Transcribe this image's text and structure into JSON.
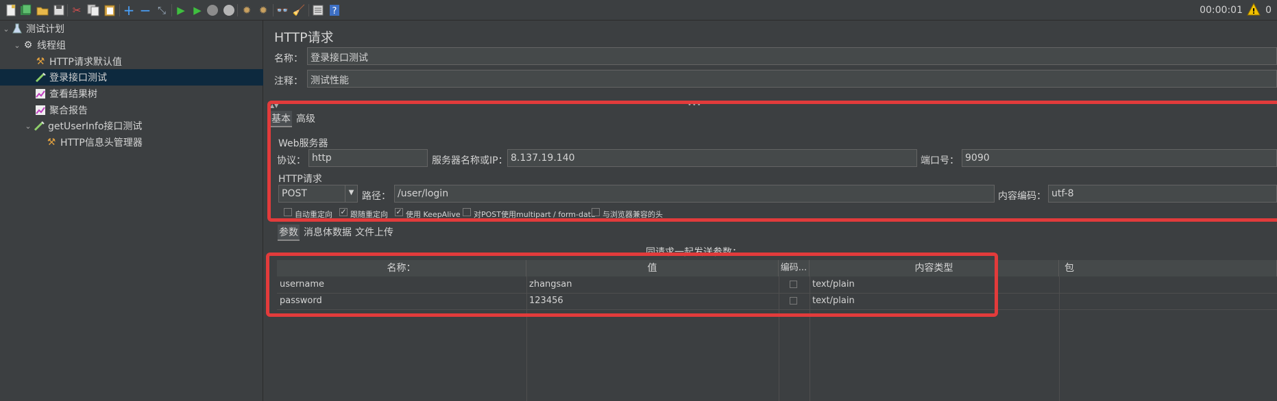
{
  "toolbar": {
    "icons": [
      "new-icon",
      "templates-icon",
      "open-icon",
      "save-icon",
      "cut-icon",
      "copy-icon",
      "paste-icon",
      "expand-icon",
      "collapse-icon",
      "toggle-icon",
      "start-icon",
      "start-no-pause-icon",
      "stop-icon",
      "shutdown-icon",
      "clear-icon",
      "clear-all-icon",
      "search-icon",
      "reset-search-icon",
      "function-helper-icon",
      "help-icon"
    ],
    "timer": "00:00:01",
    "warning_count": "0"
  },
  "tree": {
    "items": [
      {
        "label": "测试计划",
        "icon": "flask-icon",
        "expanded": true
      },
      {
        "label": "线程组",
        "icon": "gear-icon",
        "expanded": true
      },
      {
        "label": "HTTP请求默认值",
        "icon": "wrench-icon"
      },
      {
        "label": "登录接口测试",
        "icon": "pipette-icon",
        "selected": true
      },
      {
        "label": "查看结果树",
        "icon": "chart-icon"
      },
      {
        "label": "聚合报告",
        "icon": "chart-icon"
      },
      {
        "label": "getUserInfo接口测试",
        "icon": "pipette-icon",
        "expanded": true
      },
      {
        "label": "HTTP信息头管理器",
        "icon": "wrench-icon"
      }
    ]
  },
  "main": {
    "title": "HTTP请求",
    "name_label": "名称：",
    "name_value": "登录接口测试",
    "comment_label": "注释：",
    "comment_value": "测试性能",
    "tabs": [
      "基本",
      "高级"
    ],
    "web_server": {
      "section": "Web服务器",
      "protocol_label": "协议：",
      "protocol": "http",
      "server_label": "服务器名称或IP：",
      "server": "8.137.19.140",
      "port_label": "端口号：",
      "port": "9090"
    },
    "http_request": {
      "section": "HTTP请求",
      "method": "POST",
      "path_label": "路径：",
      "path": "/user/login",
      "encoding_label": "内容编码：",
      "encoding": "utf-8"
    },
    "options": [
      {
        "label": "自动重定向",
        "checked": false
      },
      {
        "label": "跟随重定向",
        "checked": true
      },
      {
        "label": "使用 KeepAlive",
        "checked": true
      },
      {
        "label": "对POST使用multipart / form-data",
        "checked": false
      },
      {
        "label": "与浏览器兼容的头",
        "checked": false
      }
    ],
    "param_tabs": [
      "参数",
      "消息体数据",
      "文件上传"
    ],
    "params_caption": "同请求一起发送参数：",
    "table": {
      "headers": [
        "名称：",
        "值",
        "编码...",
        "内容类型",
        "包"
      ],
      "rows": [
        {
          "name": "username",
          "value": "zhangsan",
          "content_type": "text/plain"
        },
        {
          "name": "password",
          "value": "123456",
          "content_type": "text/plain"
        }
      ]
    }
  },
  "colors": {
    "background": "#3c3f41",
    "selection": "#0d293e",
    "highlight_border": "#e23b3b",
    "warning": "#f0c000"
  }
}
